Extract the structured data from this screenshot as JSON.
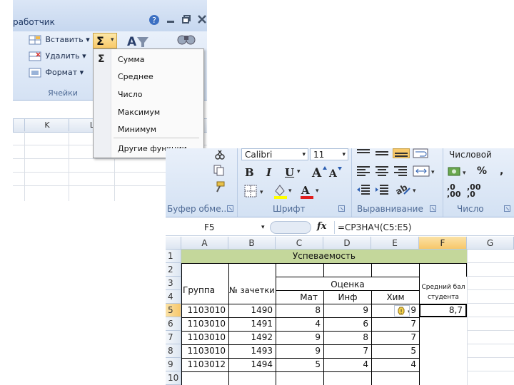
{
  "fragment1": {
    "title_partial": "работчик",
    "buttons": {
      "insert": "Вставить",
      "delete": "Удалить",
      "format": "Формат"
    },
    "group_label": "Ячейки",
    "columns": [
      "K",
      "L"
    ],
    "sum_symbol": "Σ"
  },
  "menu": {
    "items": [
      "Сумма",
      "Среднее",
      "Число",
      "Максимум",
      "Минимум"
    ],
    "more": "Другие функции..."
  },
  "fragment2": {
    "clipboard_label": "Буфер обме...",
    "font": {
      "name": "Calibri",
      "size": "11",
      "label": "Шрифт",
      "bold": "B",
      "italic": "I",
      "underline": "U"
    },
    "alignment_label": "Выравнивание",
    "number": {
      "format": "Числовой",
      "label": "Число",
      "percent": "%",
      "comma": "000",
      "inc_dec": ",00",
      "dec_dec": ",00"
    },
    "formula_bar": {
      "name_box": "F5",
      "fx": "fx",
      "formula": "=СРЗНАЧ(C5:E5)"
    },
    "columns": [
      "A",
      "B",
      "C",
      "D",
      "E",
      "F",
      "G"
    ],
    "rows": [
      "1",
      "2",
      "3",
      "4",
      "5",
      "6",
      "7",
      "8",
      "9",
      "10"
    ],
    "table": {
      "title": "Успеваемость",
      "header_group": "Группа",
      "header_book": "№ зачетки",
      "header_grade": "Оценка",
      "subjects": [
        "Мат",
        "Инф",
        "Хим"
      ],
      "avg_header": "Средний бал студента",
      "data": [
        {
          "group": "1103010",
          "book": "1490",
          "mat": "8",
          "inf": "9",
          "chem": "9",
          "avg": "8,7"
        },
        {
          "group": "1103010",
          "book": "1491",
          "mat": "4",
          "inf": "6",
          "chem": "7",
          "avg": ""
        },
        {
          "group": "1103010",
          "book": "1492",
          "mat": "9",
          "inf": "8",
          "chem": "7",
          "avg": ""
        },
        {
          "group": "1103010",
          "book": "1493",
          "mat": "9",
          "inf": "7",
          "chem": "5",
          "avg": ""
        },
        {
          "group": "1103012",
          "book": "1494",
          "mat": "5",
          "inf": "4",
          "chem": "4",
          "avg": ""
        }
      ]
    }
  },
  "colors": {
    "title_fill": "#c4d79b",
    "selected_header": "#f7c76a",
    "ribbon": "#d5e2f4"
  }
}
